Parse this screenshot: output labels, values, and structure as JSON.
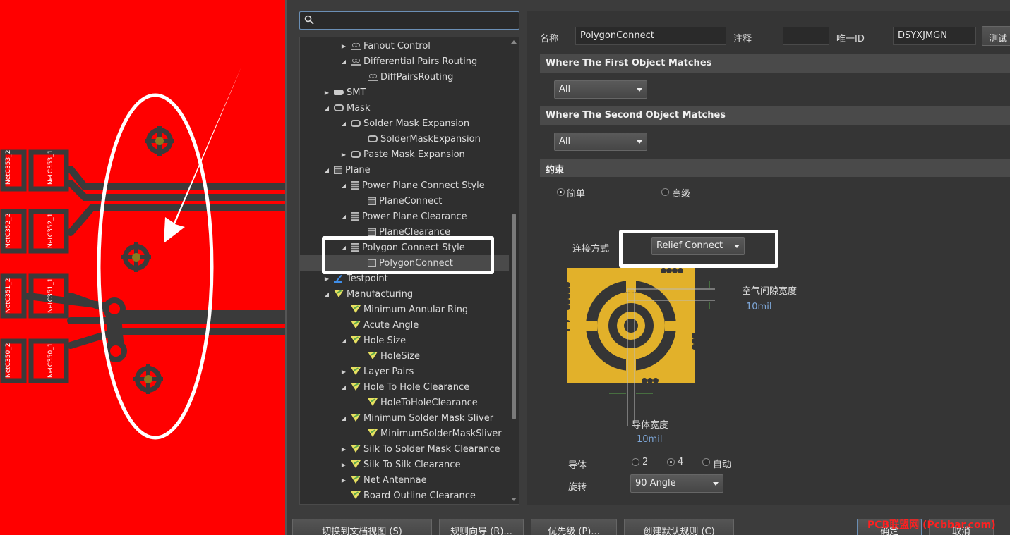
{
  "colors": {
    "pcb_background": "#ff0000",
    "track": "#3a3a3a",
    "via_copper": "#c8a020",
    "annotation": "#ffffff",
    "relief_copper": "#e2b12a"
  },
  "pcb": {
    "pad_labels": [
      "NetC353_2",
      "NetC353_1",
      "NetC352_2",
      "NetC352_1",
      "NetC351_2",
      "NetC351_1",
      "NetC350_2",
      "NetC350_1"
    ]
  },
  "search": {
    "placeholder": ""
  },
  "tree": {
    "items": [
      {
        "label": "Fanout Control",
        "icon": "fanout-icon",
        "level": 1,
        "expanded": "collapsed"
      },
      {
        "label": "Differential Pairs Routing",
        "icon": "fanout-icon",
        "level": 1,
        "expanded": "expanded"
      },
      {
        "label": "DiffPairsRouting",
        "icon": "fanout-icon",
        "level": 2,
        "expanded": "none"
      },
      {
        "label": "SMT",
        "icon": "smt-icon",
        "level": 0,
        "expanded": "collapsed"
      },
      {
        "label": "Mask",
        "icon": "mask-icon",
        "level": 0,
        "expanded": "expanded"
      },
      {
        "label": "Solder Mask Expansion",
        "icon": "mask-icon",
        "level": 1,
        "expanded": "expanded"
      },
      {
        "label": "SolderMaskExpansion",
        "icon": "mask-icon",
        "level": 2,
        "expanded": "none"
      },
      {
        "label": "Paste Mask Expansion",
        "icon": "mask-icon",
        "level": 1,
        "expanded": "collapsed"
      },
      {
        "label": "Plane",
        "icon": "plane-icon",
        "level": 0,
        "expanded": "expanded"
      },
      {
        "label": "Power Plane Connect Style",
        "icon": "plane-icon",
        "level": 1,
        "expanded": "expanded"
      },
      {
        "label": "PlaneConnect",
        "icon": "plane-icon",
        "level": 2,
        "expanded": "none"
      },
      {
        "label": "Power Plane Clearance",
        "icon": "plane-icon",
        "level": 1,
        "expanded": "expanded"
      },
      {
        "label": "PlaneClearance",
        "icon": "plane-icon",
        "level": 2,
        "expanded": "none"
      },
      {
        "label": "Polygon Connect Style",
        "icon": "plane-icon",
        "level": 1,
        "expanded": "expanded"
      },
      {
        "label": "PolygonConnect",
        "icon": "plane-icon",
        "level": 2,
        "expanded": "none",
        "selected": true
      },
      {
        "label": "Testpoint",
        "icon": "testpoint-icon",
        "level": 0,
        "expanded": "collapsed"
      },
      {
        "label": "Manufacturing",
        "icon": "manufacturing-icon",
        "level": 0,
        "expanded": "expanded"
      },
      {
        "label": "Minimum Annular Ring",
        "icon": "manufacturing-icon",
        "level": 1,
        "expanded": "none"
      },
      {
        "label": "Acute Angle",
        "icon": "manufacturing-icon",
        "level": 1,
        "expanded": "none"
      },
      {
        "label": "Hole Size",
        "icon": "manufacturing-icon",
        "level": 1,
        "expanded": "expanded"
      },
      {
        "label": "HoleSize",
        "icon": "manufacturing-icon",
        "level": 2,
        "expanded": "none"
      },
      {
        "label": "Layer Pairs",
        "icon": "manufacturing-icon",
        "level": 1,
        "expanded": "collapsed"
      },
      {
        "label": "Hole To Hole Clearance",
        "icon": "manufacturing-icon",
        "level": 1,
        "expanded": "expanded"
      },
      {
        "label": "HoleToHoleClearance",
        "icon": "manufacturing-icon",
        "level": 2,
        "expanded": "none"
      },
      {
        "label": "Minimum Solder Mask Sliver",
        "icon": "manufacturing-icon",
        "level": 1,
        "expanded": "expanded"
      },
      {
        "label": "MinimumSolderMaskSliver",
        "icon": "manufacturing-icon",
        "level": 2,
        "expanded": "none"
      },
      {
        "label": "Silk To Solder Mask Clearance",
        "icon": "manufacturing-icon",
        "level": 1,
        "expanded": "collapsed"
      },
      {
        "label": "Silk To Silk Clearance",
        "icon": "manufacturing-icon",
        "level": 1,
        "expanded": "collapsed"
      },
      {
        "label": "Net Antennae",
        "icon": "manufacturing-icon",
        "level": 1,
        "expanded": "collapsed"
      },
      {
        "label": "Board Outline Clearance",
        "icon": "manufacturing-icon",
        "level": 1,
        "expanded": "none"
      }
    ]
  },
  "props": {
    "name_label": "名称",
    "name_value": "PolygonConnect",
    "comment_label": "注释",
    "comment_value": "",
    "uid_label": "唯一ID",
    "uid_value": "DSYXJMGN",
    "test_button": "测试",
    "first_match_header": "Where The First Object Matches",
    "first_match_value": "All",
    "second_match_header": "Where The Second Object Matches",
    "second_match_value": "All",
    "constraints_header": "约束",
    "mode_simple": "简单",
    "mode_advanced": "高级",
    "mode_selected": "simple",
    "connect_label": "连接方式",
    "connect_value": "Relief Connect",
    "air_gap_label": "空气间隙宽度",
    "air_gap_value": "10mil",
    "conductor_width_label": "导体宽度",
    "conductor_width_value": "10mil",
    "conductors_label": "导体",
    "conductor_opt_2": "2",
    "conductor_opt_4": "4",
    "conductor_opt_auto": "自动",
    "conductor_selected": "4",
    "rotation_label": "旋转",
    "rotation_value": "90 Angle"
  },
  "footer": {
    "switch_view": "切换到文档视图 (S)",
    "rule_wizard": "规则向导 (R)...",
    "priority": "优先级 (P)...",
    "create_default": "创建默认规则 (C)",
    "ok": "确定",
    "cancel": "取消"
  },
  "watermark": "PCB联盟网 (Pcbbar.com)"
}
